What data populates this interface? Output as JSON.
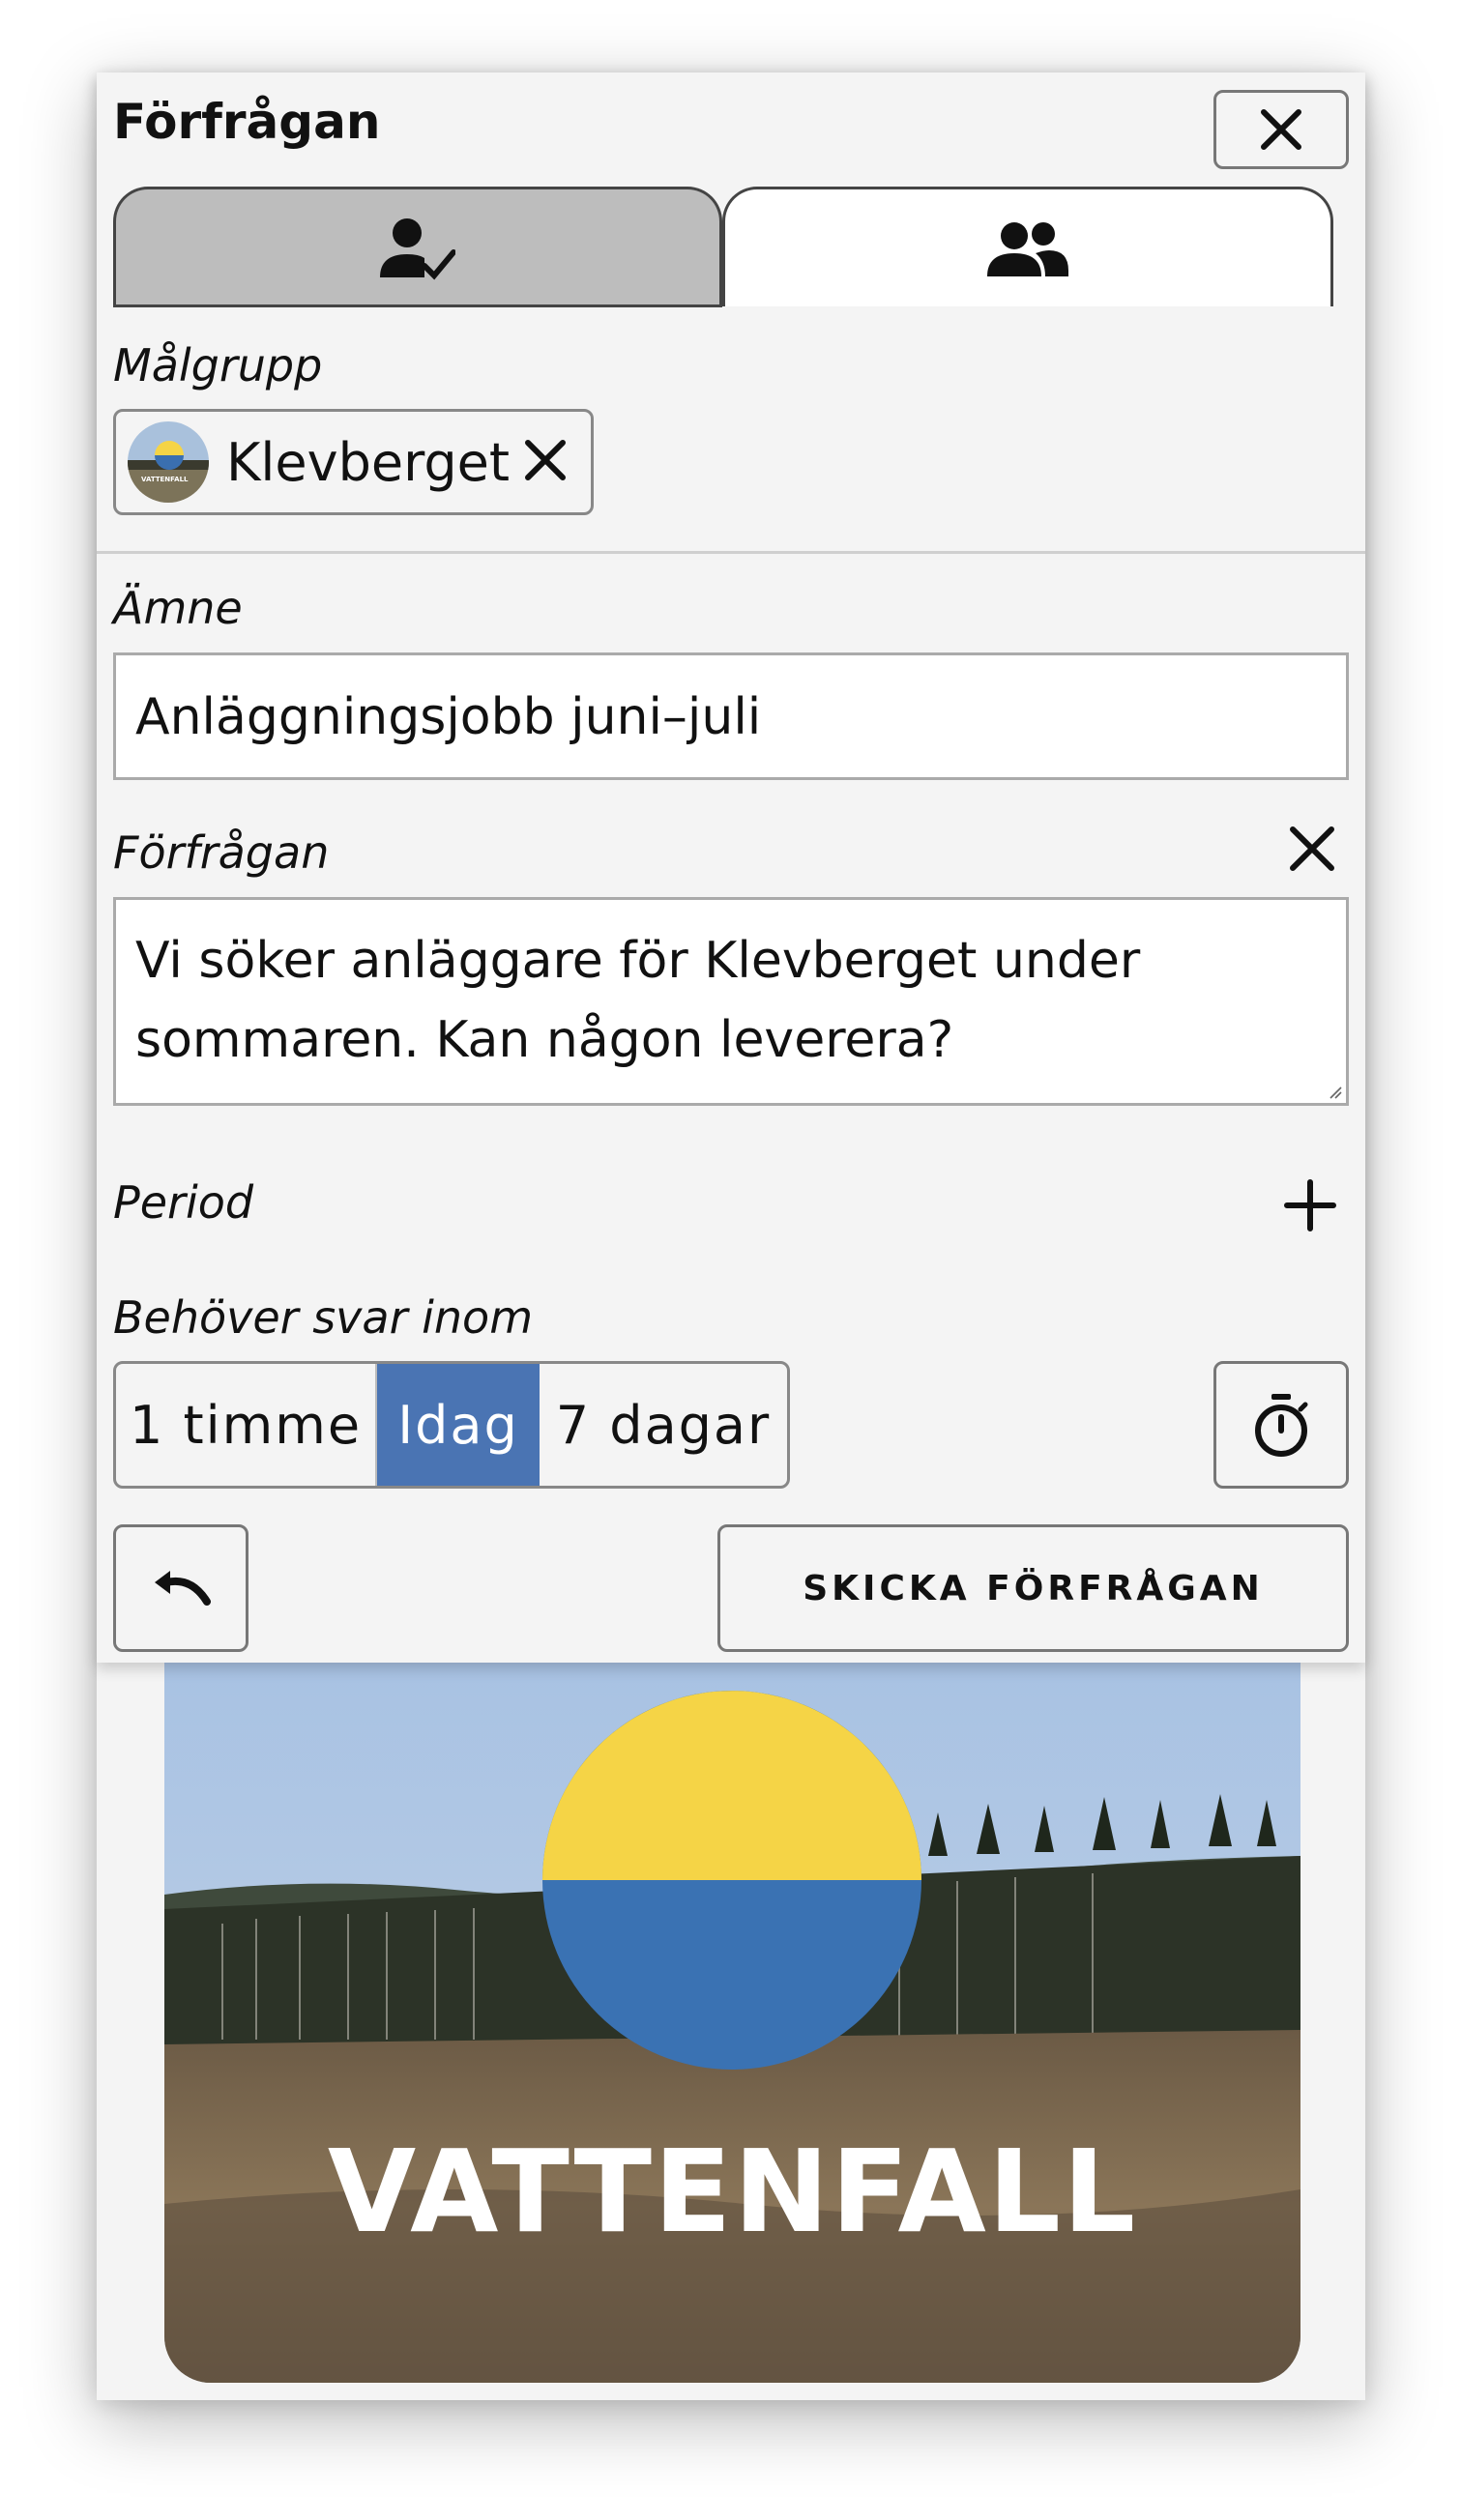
{
  "modal": {
    "title": "Förfrågan",
    "close_icon": "close-icon",
    "tabs": [
      {
        "icon": "person-check-icon",
        "active": false
      },
      {
        "icon": "group-icon",
        "active": true
      }
    ]
  },
  "target_group": {
    "label": "Målgrupp",
    "chip": {
      "text": "Klevberget",
      "avatar_text": "VATTENFALL",
      "remove_icon": "close-icon"
    }
  },
  "subject": {
    "label": "Ämne",
    "value": "Anläggningsjobb juni–juli"
  },
  "request": {
    "label": "Förfrågan",
    "value": "Vi söker anläggare för Klevberget under sommaren. Kan någon leverera?",
    "clear_icon": "close-icon"
  },
  "period": {
    "label": "Period",
    "add_icon": "plus-icon"
  },
  "deadline": {
    "label": "Behöver svar inom",
    "options": [
      "1 timme",
      "Idag",
      "7 dagar"
    ],
    "selected": "Idag",
    "timer_icon": "stopwatch-icon"
  },
  "actions": {
    "undo_icon": "undo-icon",
    "send_label": "SKICKA FÖRFRÅGAN"
  },
  "hero": {
    "brand": "VATTENFALL"
  },
  "colors": {
    "accent": "#4a74b3",
    "background": "#f4f4f4",
    "brand_yellow": "#f5d446",
    "brand_blue": "#3a72b3"
  }
}
